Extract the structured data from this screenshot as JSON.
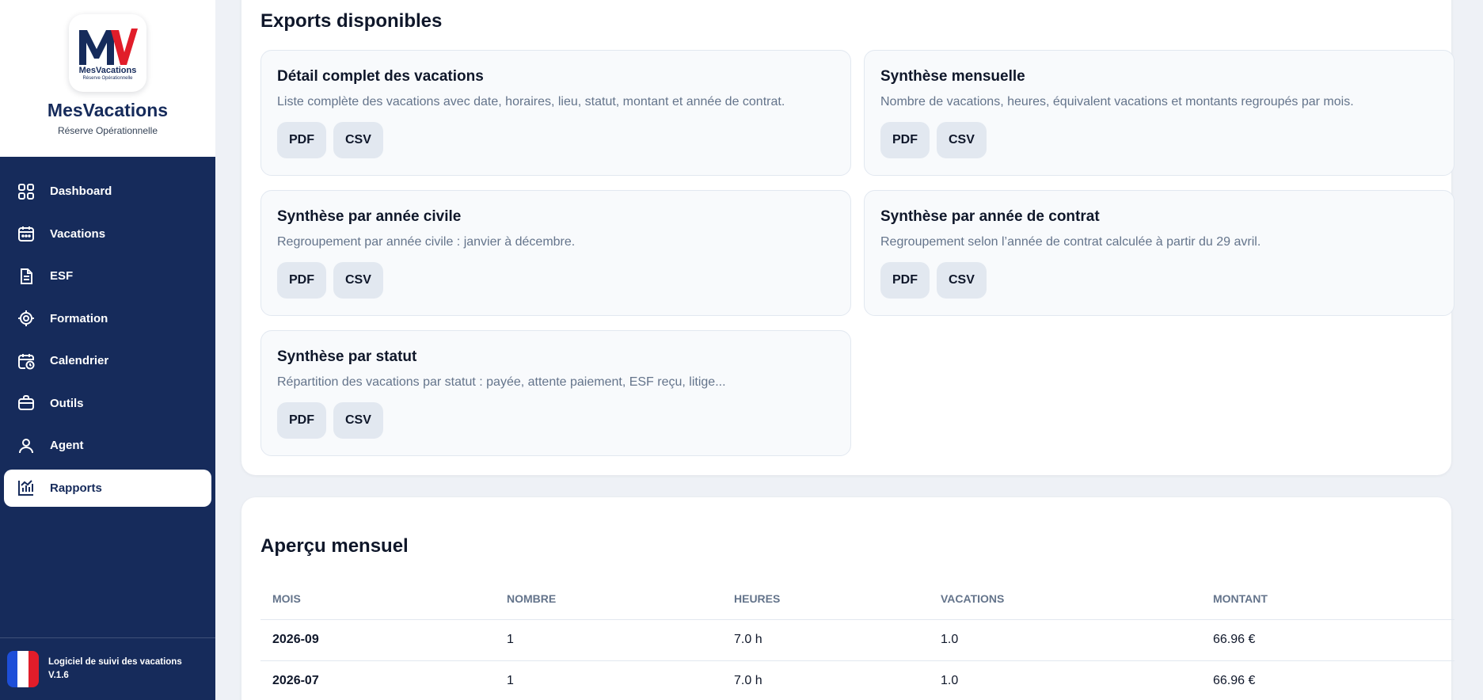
{
  "brand": {
    "logo_letters": "MV",
    "logo_caption": "MesVacations",
    "logo_sub": "Réserve Opérationnelle",
    "name": "MesVacations",
    "subtitle": "Réserve Opérationnelle",
    "colors": {
      "navy": "#162b5b",
      "red": "#e11d2a"
    }
  },
  "sidebar": {
    "items": [
      {
        "label": "Dashboard",
        "icon": "grid-icon"
      },
      {
        "label": "Vacations",
        "icon": "calendar-icon"
      },
      {
        "label": "ESF",
        "icon": "document-icon"
      },
      {
        "label": "Formation",
        "icon": "target-icon"
      },
      {
        "label": "Calendrier",
        "icon": "calendar-clock-icon"
      },
      {
        "label": "Outils",
        "icon": "briefcase-icon"
      },
      {
        "label": "Agent",
        "icon": "user-icon"
      },
      {
        "label": "Rapports",
        "icon": "chart-icon",
        "active": true
      }
    ],
    "footer": {
      "line1": "Logiciel de suivi des vacations",
      "line2": "V.1.6"
    }
  },
  "exports": {
    "title": "Exports disponibles",
    "cards": [
      {
        "title": "Détail complet des vacations",
        "desc": "Liste complète des vacations avec date, horaires, lieu, statut, montant et année de contrat.",
        "pdf": "PDF",
        "csv": "CSV"
      },
      {
        "title": "Synthèse mensuelle",
        "desc": "Nombre de vacations, heures, équivalent vacations et montants regroupés par mois.",
        "pdf": "PDF",
        "csv": "CSV"
      },
      {
        "title": "Synthèse par année civile",
        "desc": "Regroupement par année civile : janvier à décembre.",
        "pdf": "PDF",
        "csv": "CSV"
      },
      {
        "title": "Synthèse par année de contrat",
        "desc": "Regroupement selon l’année de contrat calculée à partir du 29 avril.",
        "pdf": "PDF",
        "csv": "CSV"
      },
      {
        "title": "Synthèse par statut",
        "desc": "Répartition des vacations par statut : payée, attente paiement, ESF reçu, litige...",
        "pdf": "PDF",
        "csv": "CSV"
      }
    ]
  },
  "monthly": {
    "title": "Aperçu mensuel",
    "columns": [
      "MOIS",
      "NOMBRE",
      "HEURES",
      "VACATIONS",
      "MONTANT"
    ],
    "rows": [
      [
        "2026-09",
        "1",
        "7.0 h",
        "1.0",
        "66.96 €"
      ],
      [
        "2026-07",
        "1",
        "7.0 h",
        "1.0",
        "66.96 €"
      ]
    ]
  }
}
